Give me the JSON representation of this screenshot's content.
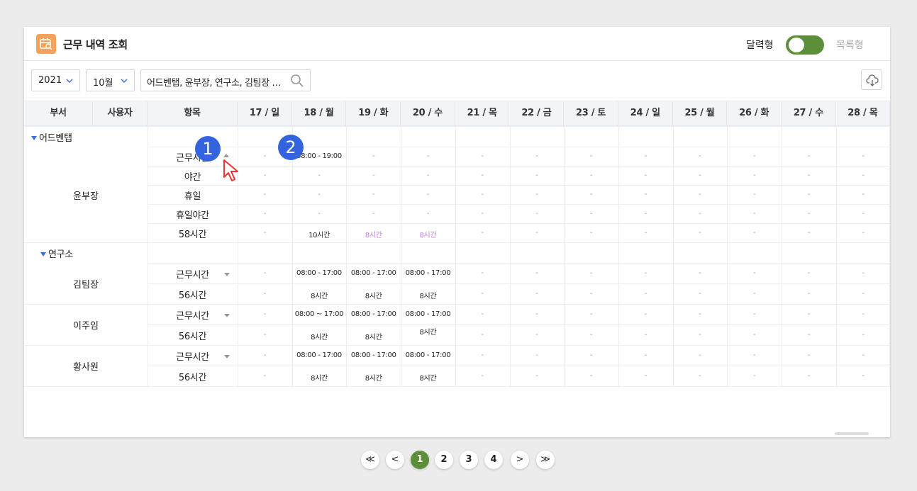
{
  "header": {
    "title": "근무 내역 조회",
    "view_calendar": "달력형",
    "view_list": "목록형",
    "toggle_on": true
  },
  "filters": {
    "year": "2021",
    "month": "10월",
    "search_value": "어드벤탭, 윤부장, 연구소, 김팀장 …"
  },
  "columns": {
    "dept": "부서",
    "user": "사용자",
    "item": "항목",
    "days": [
      "17 / 일",
      "18 / 월",
      "19 / 화",
      "20 / 수",
      "21 / 목",
      "22 / 금",
      "23 / 토",
      "24 / 일",
      "25 / 월",
      "26 / 화",
      "27 / 수",
      "28 / 목"
    ]
  },
  "groups": [
    {
      "dept": "어드벤탭",
      "users": [
        {
          "name": "윤부장",
          "rows": [
            {
              "item": "근무시간",
              "values": [
                "-",
                "08:00 - 19:00",
                "-",
                "-",
                "-",
                "-",
                "-",
                "-",
                "-",
                "-",
                "-",
                "-"
              ]
            },
            {
              "item": "야간",
              "values": [
                "-",
                "-",
                "-",
                "-",
                "-",
                "-",
                "-",
                "-",
                "-",
                "-",
                "-",
                "-"
              ]
            },
            {
              "item": "휴일",
              "values": [
                "-",
                "-",
                "-",
                "-",
                "-",
                "-",
                "-",
                "-",
                "-",
                "-",
                "-",
                "-"
              ]
            },
            {
              "item": "휴일야간",
              "values": [
                "-",
                "-",
                "-",
                "-",
                "-",
                "-",
                "-",
                "-",
                "-",
                "-",
                "-",
                "-"
              ]
            },
            {
              "item": "58시간",
              "values": [
                "-",
                "10시간",
                "8시간",
                "8시간",
                "-",
                "-",
                "-",
                "-",
                "-",
                "-",
                "-",
                "-"
              ]
            }
          ]
        }
      ]
    },
    {
      "dept": "연구소",
      "users": [
        {
          "name": "김팀장",
          "rows": [
            {
              "item": "근무시간",
              "values": [
                "-",
                "08:00 - 17:00",
                "08:00 - 17:00",
                "08:00 - 17:00",
                "-",
                "-",
                "-",
                "-",
                "-",
                "-",
                "-",
                "-"
              ]
            },
            {
              "item": "56시간",
              "values": [
                "-",
                "8시간",
                "8시간",
                "8시간",
                "-",
                "-",
                "-",
                "-",
                "-",
                "-",
                "-",
                "-"
              ]
            }
          ]
        },
        {
          "name": "이주임",
          "rows": [
            {
              "item": "근무시간",
              "values": [
                "-",
                "08:00 ~ 17:00",
                "08:00 - 17:00",
                "08:00 - 17:00",
                "-",
                "-",
                "-",
                "-",
                "-",
                "-",
                "-",
                "-"
              ]
            },
            {
              "item": "56시간",
              "values": [
                "-",
                "8시간",
                "8시간",
                "8시간",
                "-",
                "-",
                "-",
                "-",
                "-",
                "-",
                "-",
                "-"
              ]
            }
          ]
        },
        {
          "name": "황사원",
          "rows": [
            {
              "item": "근무시간",
              "values": [
                "-",
                "08:00 - 17:00",
                "08:00 - 17:00",
                "08:00 - 17:00",
                "-",
                "-",
                "-",
                "-",
                "-",
                "-",
                "-",
                "-"
              ]
            },
            {
              "item": "56시간",
              "values": [
                "-",
                "8시간",
                "8시간",
                "8시간",
                "-",
                "-",
                "-",
                "-",
                "-",
                "-",
                "-",
                "-"
              ]
            }
          ]
        }
      ]
    }
  ],
  "annotations": {
    "badge_1": "1",
    "badge_2": "2"
  },
  "pagination": {
    "first": "≪",
    "prev": "<",
    "pages": [
      "1",
      "2",
      "3",
      "4"
    ],
    "next": ">",
    "last": "≫",
    "current": "1"
  },
  "colors": {
    "accent": "#5d8f3a",
    "badge": "#3463e0",
    "highlight": "#c37dd8"
  }
}
